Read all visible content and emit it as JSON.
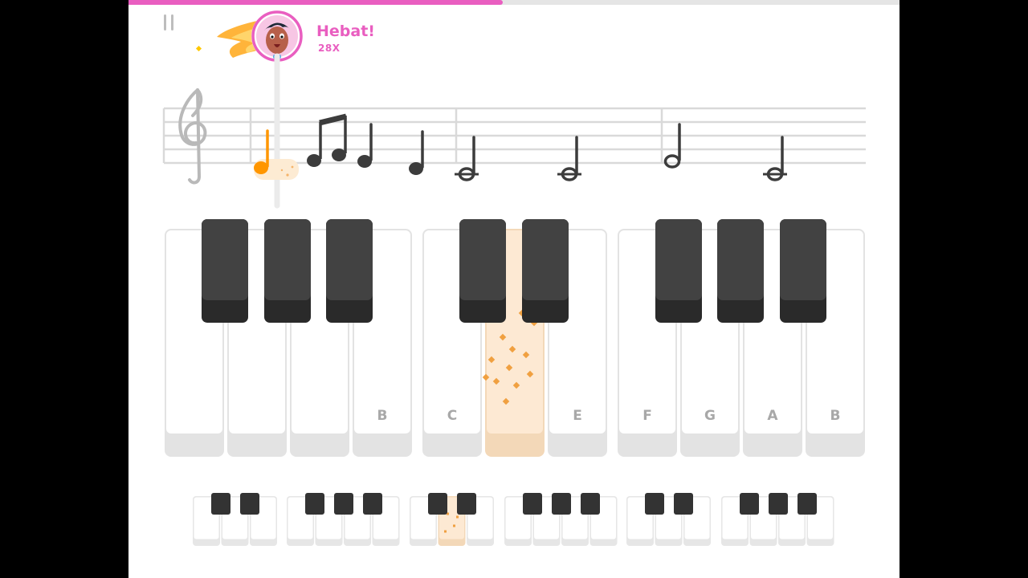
{
  "progress": {
    "percent": 48.5,
    "fill_color": "#e95ec0"
  },
  "pause_button": {
    "icon": "pause-icon"
  },
  "combo": {
    "title": "Hebat!",
    "count": "28X",
    "color": "#e95ec0"
  },
  "avatar": {
    "icon": "character-avatar",
    "flame_color": "#ff9b21"
  },
  "staff": {
    "clef": "treble-clef-icon",
    "current_note_color": "#ff9600",
    "note_color": "#3c3c3c"
  },
  "keyboard": {
    "labels": [
      "B",
      "C",
      "E",
      "F",
      "G",
      "A",
      "B"
    ],
    "active_key_color": "#fde9d3"
  },
  "mini_keyboard": {
    "active_group": 3
  }
}
